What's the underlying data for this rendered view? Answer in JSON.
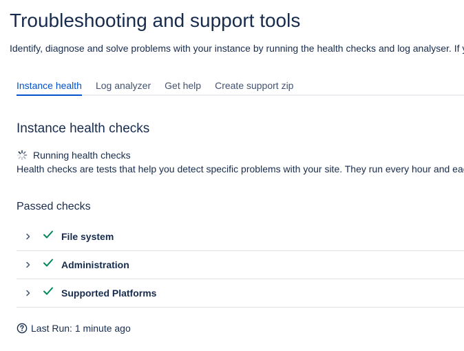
{
  "page": {
    "title": "Troubleshooting and support tools",
    "description": "Identify, diagnose and solve problems with your instance by running the health checks and log analyser. If y"
  },
  "tabs": [
    {
      "label": "Instance health",
      "active": true
    },
    {
      "label": "Log analyzer",
      "active": false
    },
    {
      "label": "Get help",
      "active": false
    },
    {
      "label": "Create support zip",
      "active": false
    }
  ],
  "health": {
    "title": "Instance health checks",
    "running_label": "Running health checks",
    "explanation": "Health checks are tests that help you detect specific problems with your site. They run every hour and eac",
    "passed_title": "Passed checks",
    "checks": [
      {
        "label": "File system",
        "status": "passed",
        "icon": "checkmark-icon"
      },
      {
        "label": "Administration",
        "status": "passed",
        "icon": "checkmark-icon"
      },
      {
        "label": "Supported Platforms",
        "status": "passed",
        "icon": "checkmark-icon"
      }
    ],
    "last_run": "Last Run: 1 minute ago"
  },
  "colors": {
    "accent": "#0052cc",
    "success": "#00875a",
    "text": "#172b4d",
    "muted": "#42526e",
    "divider": "#dfe1e6"
  },
  "icons": {
    "spinner": "spinner-icon",
    "chevron": "chevron-right-icon",
    "check": "checkmark-icon",
    "help": "question-circle-icon"
  }
}
